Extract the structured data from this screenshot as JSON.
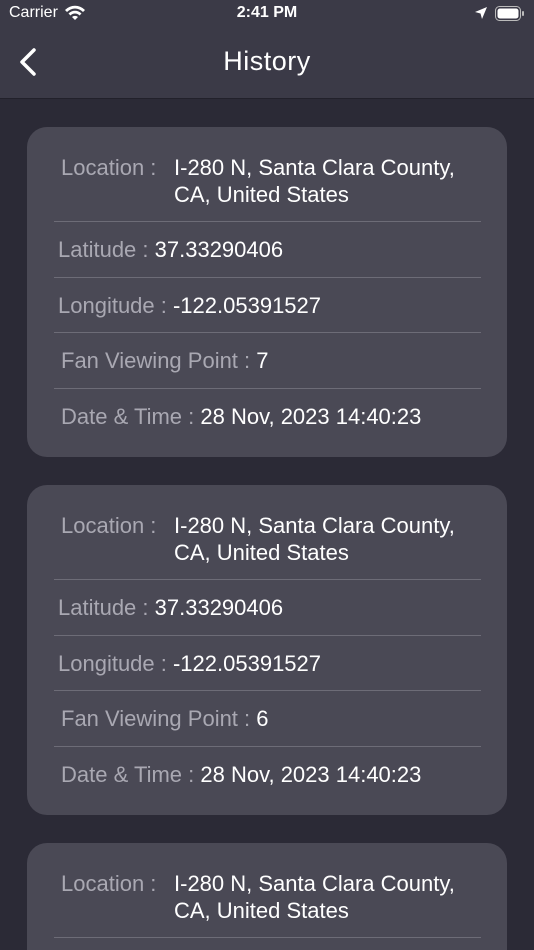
{
  "status_bar": {
    "carrier": "Carrier",
    "time": "2:41 PM"
  },
  "nav": {
    "title": "History"
  },
  "labels": {
    "location": "Location : ",
    "latitude": "Latitude : ",
    "longitude": "Longitude : ",
    "fan_viewing_point": "Fan Viewing Point : ",
    "date_time": "Date & Time : "
  },
  "records": [
    {
      "location": "I-280 N, Santa Clara County, CA, United States",
      "latitude": "37.33290406",
      "longitude": "-122.05391527",
      "fan_viewing_point": "7",
      "date_time": "28 Nov, 2023 14:40:23"
    },
    {
      "location": "I-280 N, Santa Clara County, CA, United States",
      "latitude": "37.33290406",
      "longitude": "-122.05391527",
      "fan_viewing_point": "6",
      "date_time": "28 Nov, 2023 14:40:23"
    },
    {
      "location": "I-280 N, Santa Clara County, CA, United States"
    }
  ],
  "colors": {
    "background": "#2b2a36",
    "bar": "#3b3a47",
    "card": "#4a4955",
    "label": "#a9a8b2",
    "value": "#ffffff"
  }
}
